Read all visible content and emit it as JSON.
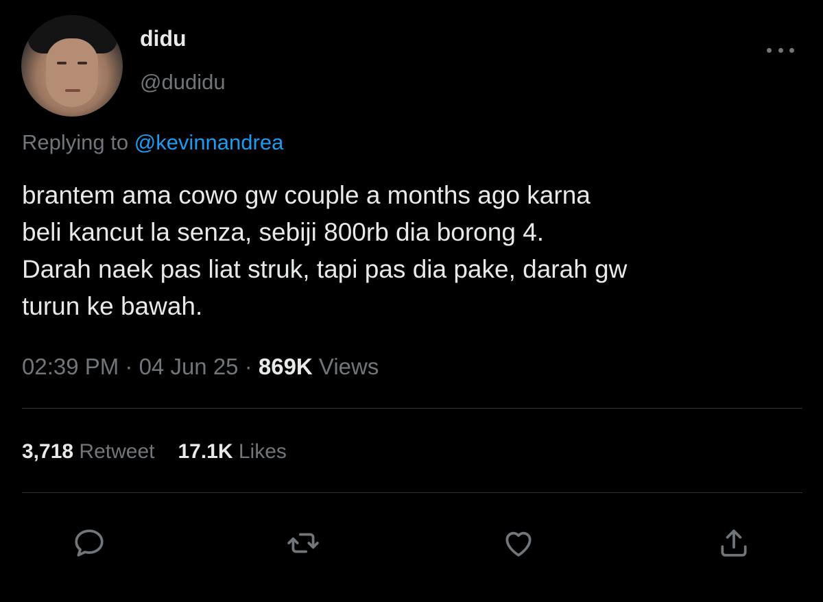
{
  "user": {
    "display_name": "didu",
    "handle": "@dudidu"
  },
  "reply": {
    "prefix": "Replying to ",
    "mention": "@kevinnandrea"
  },
  "tweet": {
    "lines": [
      "brantem ama cowo gw couple a months ago karna",
      "beli kancut la senza, sebiji 800rb dia borong 4.",
      "Darah naek pas liat struk, tapi pas dia pake, darah gw",
      "turun ke bawah."
    ]
  },
  "meta": {
    "time": "02:39 PM",
    "sep1": " · ",
    "date": "04 Jun 25",
    "sep2": " · ",
    "views_count": "869K",
    "views_label": " Views"
  },
  "stats": {
    "retweets_count": "3,718",
    "retweets_label": " Retweet",
    "likes_count": "17.1K",
    "likes_label": " Likes"
  },
  "actions": {
    "icons": [
      "reply-icon",
      "retweet-icon",
      "like-icon",
      "share-icon"
    ]
  },
  "colors": {
    "background": "#000000",
    "text": "#e7e9ea",
    "secondary": "#71767b",
    "accent": "#1d9bf0",
    "divider": "#2f3336"
  }
}
